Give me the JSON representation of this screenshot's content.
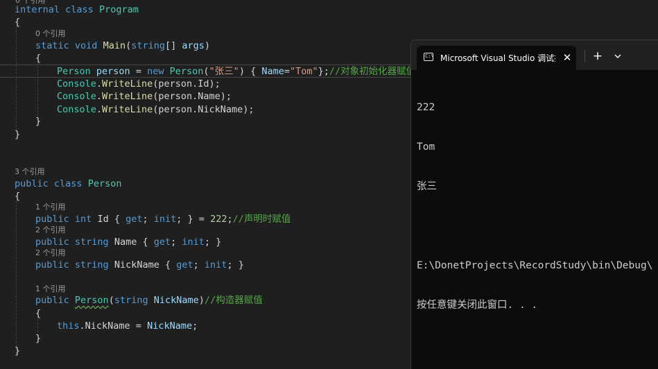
{
  "editor": {
    "lens_top_partial": "0 个引用",
    "program_header": [
      "internal",
      "class",
      "Program"
    ],
    "open_brace": "{",
    "close_brace": "}",
    "main_lens": "0 个引用",
    "main_sig": {
      "static": "static",
      "void": "void",
      "name": "Main",
      "type": "string",
      "brackets": "[] ",
      "param": "args",
      "close": ")"
    },
    "main_body": {
      "line1": {
        "type": "Person",
        "var": "person",
        "eq": " = ",
        "new": "new",
        "ctor": "Person",
        "paren": "(",
        "str": "\"张三\"",
        "init": ") { ",
        "prop": "Name",
        "eq2": "=",
        "str2": "\"Tom\"",
        "end": "};",
        "comment": "//对象初始化器赋值"
      },
      "line2": {
        "console": "Console",
        "dot": ".",
        "method": "WriteLine",
        "arg": "(person.Id);"
      },
      "line3": {
        "console": "Console",
        "dot": ".",
        "method": "WriteLine",
        "arg": "(person.Name);"
      },
      "line4": {
        "console": "Console",
        "dot": ".",
        "method": "WriteLine",
        "arg": "(person.NickName);"
      }
    },
    "person_lens": "3 个引用",
    "person_header": [
      "public",
      "class",
      "Person"
    ],
    "id_lens": "1 个引用",
    "id_line": {
      "public": "public",
      "type": "int",
      "name": "Id",
      "acc": " { ",
      "get": "get",
      "semi": "; ",
      "init": "init",
      "rest": "; } = ",
      "value": "222",
      "end": ";",
      "comment": "//声明时赋值"
    },
    "name_lens": "2 个引用",
    "name_line": {
      "public": "public",
      "type": "string",
      "name": "Name",
      "acc": " { ",
      "get": "get",
      "semi": "; ",
      "init": "init",
      "rest": "; }"
    },
    "nick_lens": "2 个引用",
    "nick_line": {
      "public": "public",
      "type": "string",
      "name": "NickName",
      "acc": " { ",
      "get": "get",
      "semi": "; ",
      "init": "init",
      "rest": "; }"
    },
    "ctor_lens": "1 个引用",
    "ctor_line": {
      "public": "public",
      "name": "Person",
      "paren": "(",
      "type": "string",
      "param": "NickName",
      "close": ")",
      "comment": "//构造器赋值"
    },
    "ctor_body": {
      "this": "this",
      "dot": ".NickName = ",
      "param": "NickName",
      "end": ";"
    }
  },
  "console": {
    "tab_title": "Microsoft Visual Studio 调试控制台",
    "tab_icon_text": "C:\\",
    "close_icon": "✕",
    "add_icon": "+",
    "dropdown_icon": "chevron-down-icon",
    "output": [
      "222",
      "Tom",
      "张三",
      "",
      "E:\\DonetProjects\\RecordStudy\\bin\\Debug\\",
      "按任意键关闭此窗口. . ."
    ]
  }
}
